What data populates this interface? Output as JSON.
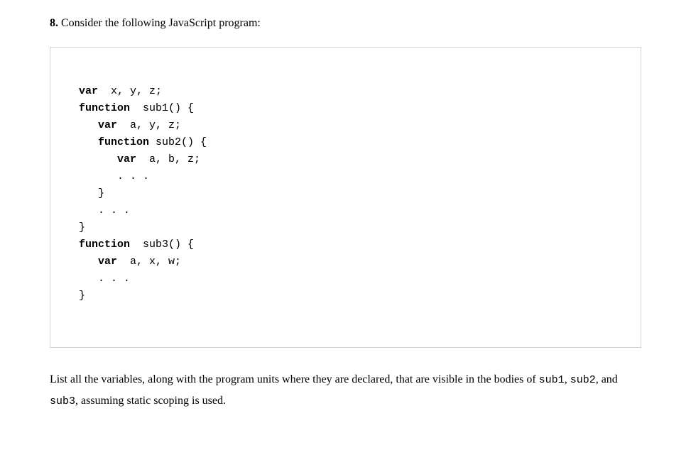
{
  "question": {
    "number": "8.",
    "intro": "Consider the following JavaScript program:"
  },
  "code": {
    "l1_kw": "var",
    "l1_rest": "  x, y, z;",
    "l2_kw": "function",
    "l2_rest": "  sub1() {",
    "l3_pad": "   ",
    "l3_kw": "var",
    "l3_rest": "  a, y, z;",
    "l4_pad": "   ",
    "l4_kw": "function",
    "l4_rest": " sub2() {",
    "l5_pad": "      ",
    "l5_kw": "var",
    "l5_rest": "  a, b, z;",
    "l6": "      . . .",
    "l7": "   }",
    "l8": "   . . .",
    "l9": "}",
    "l10_kw": "function",
    "l10_rest": "  sub3() {",
    "l11_pad": "   ",
    "l11_kw": "var",
    "l11_rest": "  a, x, w;",
    "l12": "   . . .",
    "l13": "}"
  },
  "prompt": {
    "part1": "List all the variables, along with the program units where they are declared, that are visible in the bodies of ",
    "sub1": "sub1",
    "comma1": ", ",
    "sub2": "sub2",
    "comma2": ", and ",
    "sub3": "sub3",
    "part2": ", assuming static scoping is used."
  }
}
